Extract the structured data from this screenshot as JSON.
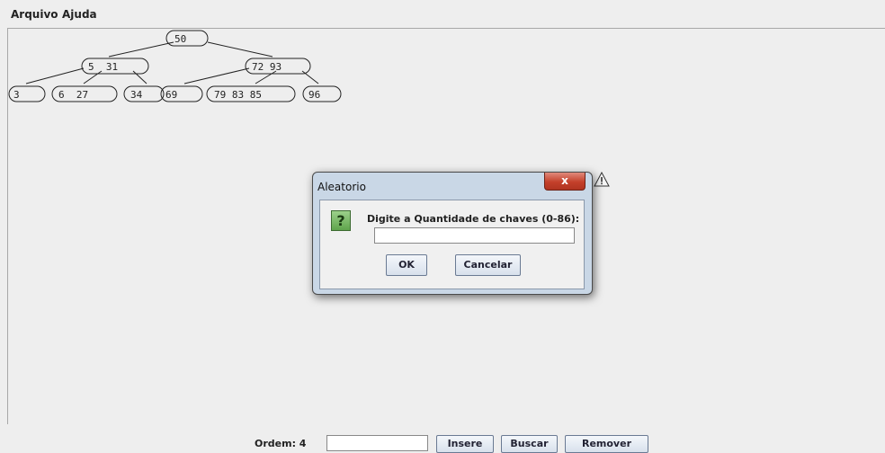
{
  "menubar": {
    "items": [
      "Arquivo",
      "Ajuda"
    ]
  },
  "tree": {
    "nodes": [
      {
        "id": "root",
        "keys": "50"
      },
      {
        "id": "left",
        "keys": "5  31"
      },
      {
        "id": "right",
        "keys": "72 93"
      },
      {
        "id": "leaf1",
        "keys": "3"
      },
      {
        "id": "leaf2",
        "keys": "6  27"
      },
      {
        "id": "leaf3",
        "keys": "34"
      },
      {
        "id": "leaf4",
        "keys": "69"
      },
      {
        "id": "leaf5",
        "keys": "79 83 85"
      },
      {
        "id": "leaf6",
        "keys": "96"
      }
    ]
  },
  "bottombar": {
    "ordem_label": "Ordem: 4",
    "input_value": "",
    "insere_label": "Insere",
    "buscar_label": "Buscar",
    "remover_label": "Remover"
  },
  "dialog": {
    "title": "Aleatorio",
    "close_glyph": "x",
    "icon_glyph": "?",
    "prompt": "Digite a Quantidade de chaves (0-86):",
    "input_value": "",
    "ok_label": "OK",
    "cancel_label": "Cancelar"
  },
  "colors": {
    "background": "#eeeeee",
    "dialog_frame": "#c9d7e6",
    "close_red": "#c4402a",
    "question_green": "#5fa44c"
  },
  "icons": {
    "question": "question-icon",
    "warning": "warning-icon",
    "close": "close-icon"
  }
}
